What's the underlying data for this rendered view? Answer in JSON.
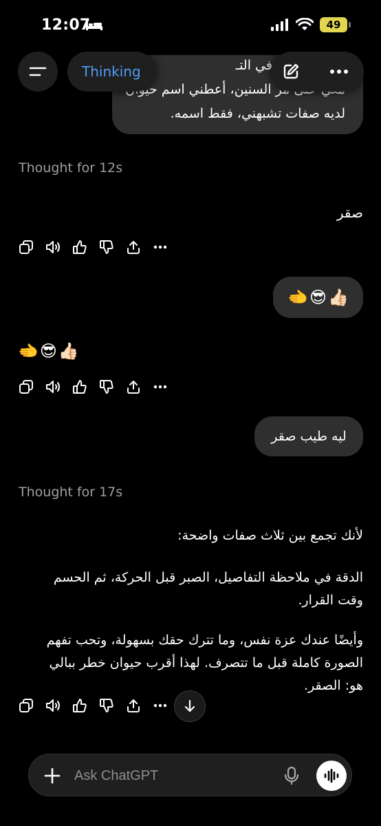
{
  "status_bar": {
    "time": "12:07",
    "battery": "49"
  },
  "toolbar": {
    "thinking_label": "Thinking"
  },
  "messages": {
    "user_1_lines": [
      "تك الشخصية في التـ",
      "معي على مر السنين، أعطني اسم حيوان",
      "لديه صفات تشبهني، فقط اسمه."
    ],
    "thought_1": "Thought for 12s",
    "assistant_1": "صقر",
    "user_2_emoji": [
      "👍🏻",
      "😎",
      "🫲"
    ],
    "assistant_2_emoji": [
      "👍🏻",
      "😎",
      "🫲"
    ],
    "user_3": "ليه طيب صقر",
    "thought_2": "Thought for 17s",
    "assistant_3_p1": "لأنك تجمع بين ثلاث صفات واضحة:",
    "assistant_3_p2_lines": [
      "الدقة في ملاحظة التفاصيل، الصبر قبل الحركة، ثم الحسم",
      "وقت القرار."
    ],
    "assistant_3_p3_lines": [
      "وأيضًا عندك عزة نفس، وما تترك حقك بسهولة، وتحب تفهم",
      "الصورة كاملة قبل ما تتصرف. لهذا أقرب حيوان خطر ببالي",
      "هو: الصقر."
    ]
  },
  "composer": {
    "placeholder": "Ask ChatGPT"
  },
  "icons": [
    "bed-icon",
    "signal-icon",
    "wifi-icon",
    "menu-icon",
    "edit-icon",
    "more-icon",
    "copy-icon",
    "speaker-icon",
    "thumbs-up-icon",
    "thumbs-down-icon",
    "share-icon",
    "plus-icon",
    "mic-icon",
    "voice-icon",
    "arrow-down-icon"
  ],
  "colors": {
    "accent": "#4f9cf7",
    "background": "#000000",
    "bubble": "#2f2f2f",
    "muted": "#a0a0a0",
    "battery": "#e3d64f"
  }
}
